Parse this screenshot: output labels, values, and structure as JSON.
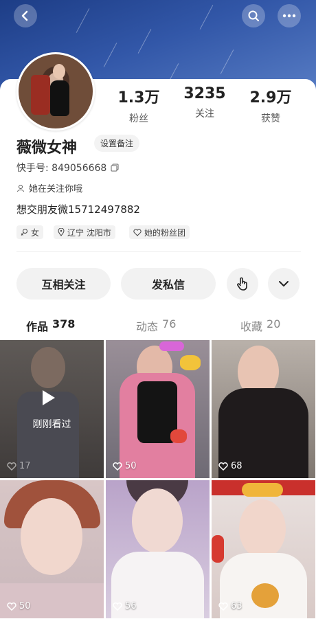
{
  "topbar": {
    "back_icon": "chevron-left-icon",
    "search_icon": "search-icon",
    "more_icon": "more-icon"
  },
  "profile": {
    "name": "薇微女神",
    "remark_button": "设置备注",
    "kuaishou_id": "快手号: 849056668",
    "follow_notice": "她在关注你哦",
    "bio": "想交朋友微15712497882",
    "tags": [
      "女",
      "辽宁 沈阳市",
      "她的粉丝团"
    ]
  },
  "stats": [
    {
      "value": "1.3万",
      "label": "粉丝"
    },
    {
      "value": "3235",
      "label": "关注"
    },
    {
      "value": "2.9万",
      "label": "获赞"
    }
  ],
  "actions": {
    "mutual_follow": "互相关注",
    "send_message": "发私信"
  },
  "tabs": [
    {
      "label": "作品",
      "count": "378"
    },
    {
      "label": "动态",
      "count": "76"
    },
    {
      "label": "收藏",
      "count": "20"
    }
  ],
  "grid": {
    "seen_label": "刚刚看过",
    "likes": [
      "17",
      "50",
      "68",
      "50",
      "56",
      "63"
    ]
  },
  "colors": {
    "header_blue": "#2e56a6",
    "pill_bg": "#f2f2f2"
  }
}
